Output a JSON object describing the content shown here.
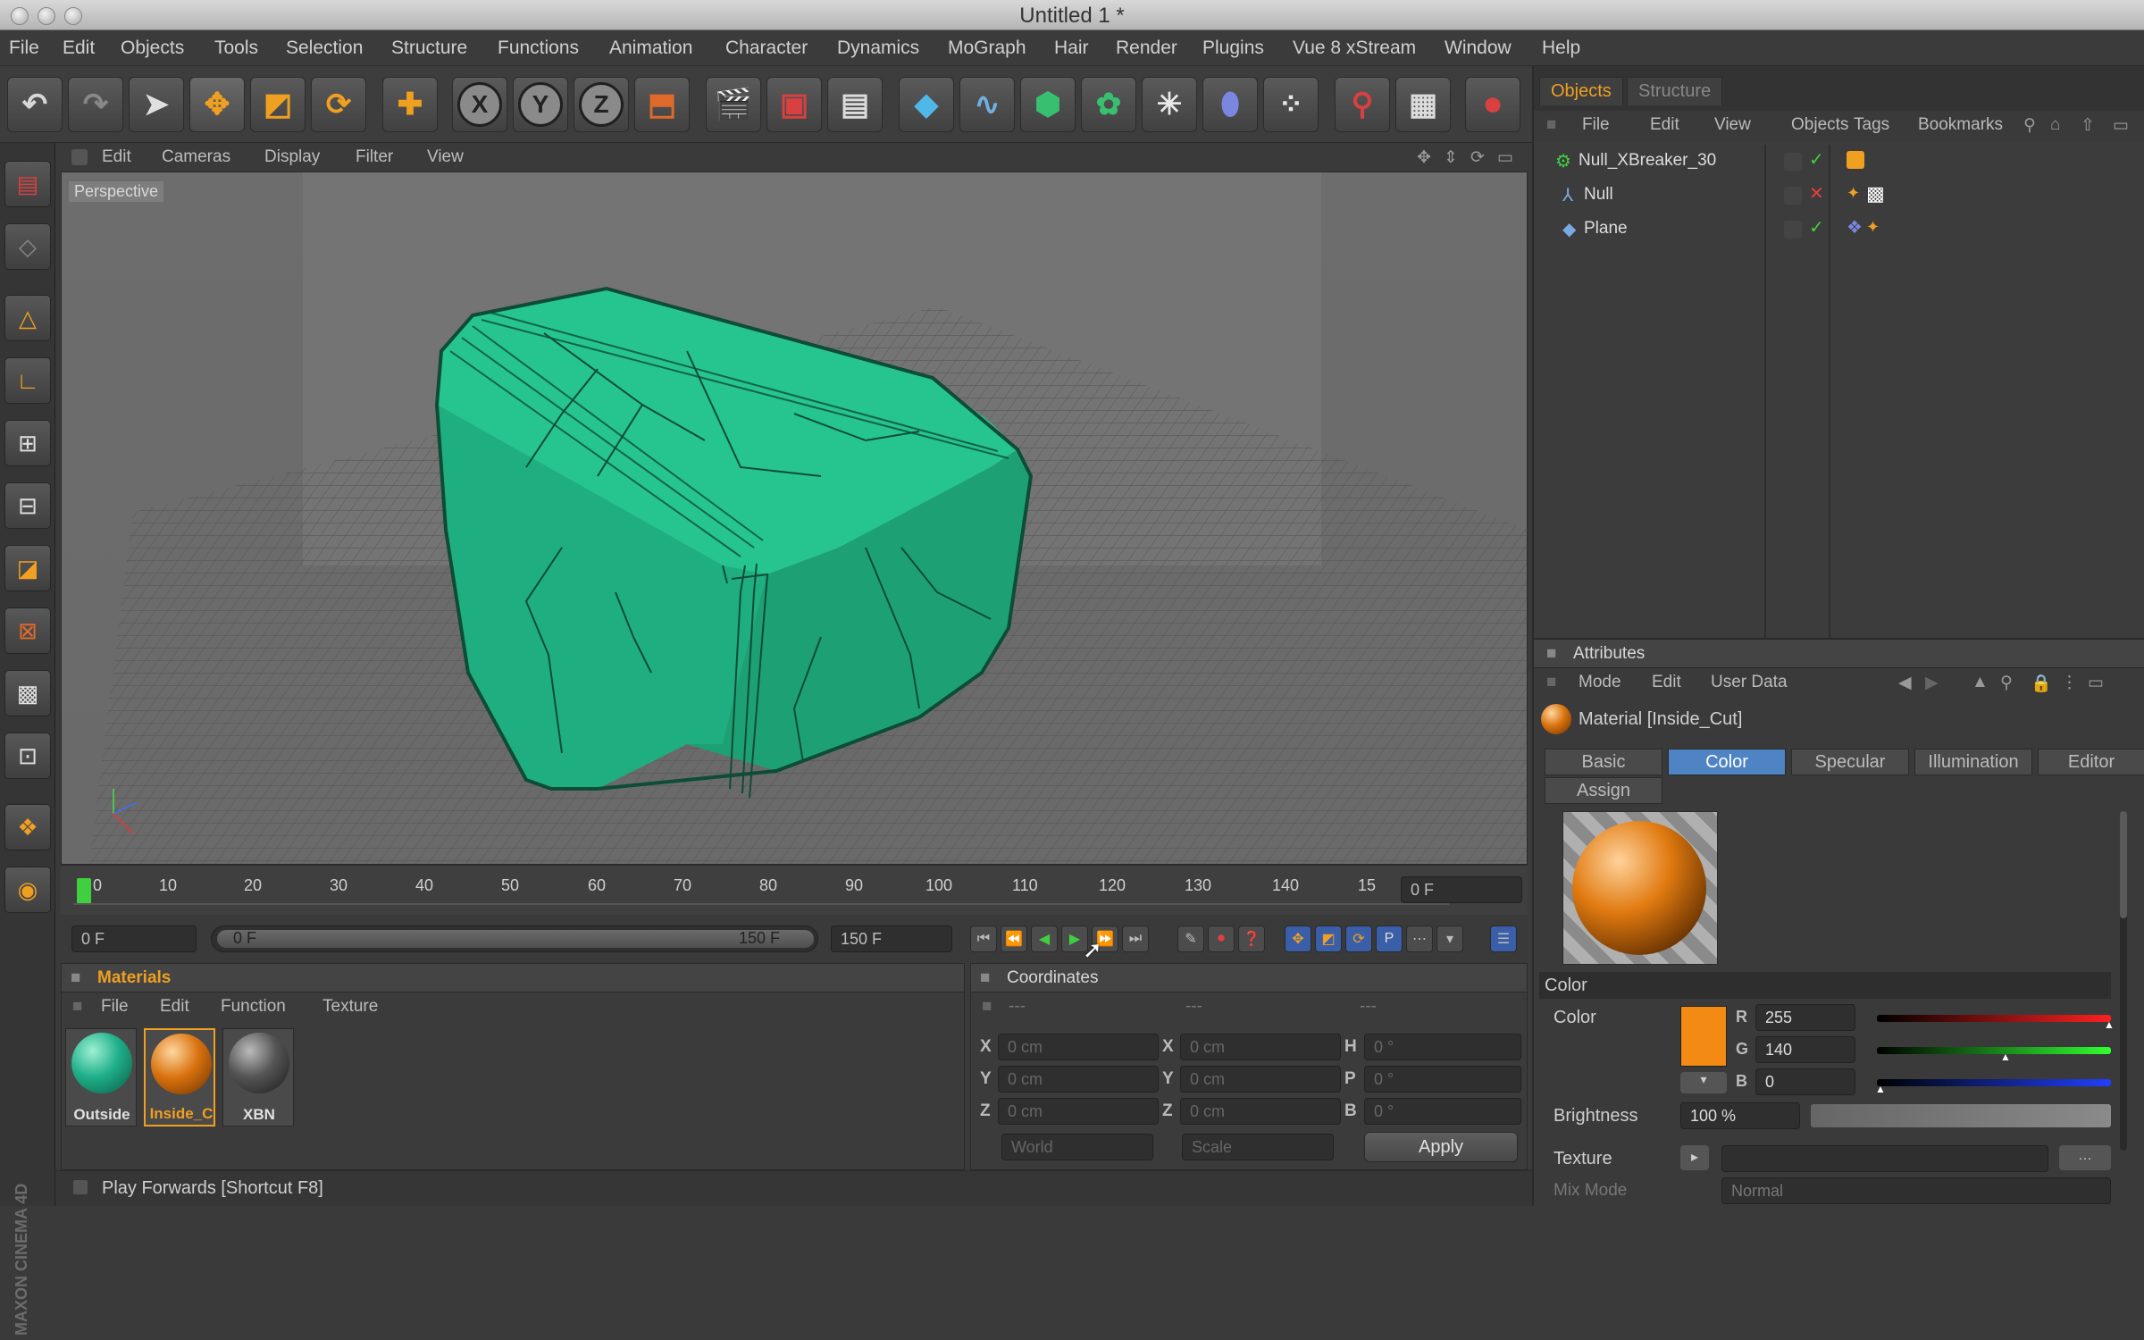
{
  "window": {
    "title": "Untitled 1 *"
  },
  "menubar": [
    "File",
    "Edit",
    "Objects",
    "Tools",
    "Selection",
    "Structure",
    "Functions",
    "Animation",
    "Character",
    "Dynamics",
    "MoGraph",
    "Hair",
    "Render",
    "Plugins",
    "Vue 8 xStream",
    "Window",
    "Help"
  ],
  "toolbar": {
    "icons": [
      "undo-icon",
      "redo-icon",
      "live-select-icon",
      "move-icon",
      "scale-icon",
      "rotate-icon",
      "world-axis-icon",
      "x-axis-icon",
      "y-axis-icon",
      "z-axis-icon",
      "coordinate-system-icon",
      "render-view-icon",
      "render-picture-viewer-icon",
      "render-settings-icon",
      "cube-primitive-icon",
      "spline-icon",
      "nurbs-icon",
      "array-icon",
      "particle-icon",
      "deformer-icon",
      "scene-icon",
      "light-icon",
      "camera-icon",
      "mograph-icon"
    ],
    "axis_labels": {
      "x": "X",
      "y": "Y",
      "z": "Z"
    }
  },
  "viewport": {
    "menu": [
      "Edit",
      "Cameras",
      "Display",
      "Filter",
      "View"
    ],
    "label": "Perspective",
    "object_color": "#1fb07a"
  },
  "timeline": {
    "ticks": [
      "0",
      "10",
      "20",
      "30",
      "40",
      "50",
      "60",
      "70",
      "80",
      "90",
      "100",
      "110",
      "120",
      "130",
      "140",
      "15"
    ],
    "current_frame": "0 F",
    "start_field": "0 F",
    "range_start": "0 F",
    "range_end": "150 F",
    "end_field": "150 F"
  },
  "materials": {
    "title": "Materials",
    "menu": [
      "File",
      "Edit",
      "Function",
      "Texture"
    ],
    "items": [
      {
        "name": "Outside",
        "color": "#1fb08a"
      },
      {
        "name": "Inside_C",
        "color": "#d9730f"
      },
      {
        "name": "XBN",
        "color": "#555555"
      }
    ]
  },
  "coordinates": {
    "title": "Coordinates",
    "headers": [
      "---",
      "---",
      "---"
    ],
    "rows": [
      {
        "pos_label": "X",
        "pos": "0 cm",
        "size_label": "X",
        "size": "0 cm",
        "rot_label": "H",
        "rot": "0 °"
      },
      {
        "pos_label": "Y",
        "pos": "0 cm",
        "size_label": "Y",
        "size": "0 cm",
        "rot_label": "P",
        "rot": "0 °"
      },
      {
        "pos_label": "Z",
        "pos": "0 cm",
        "size_label": "Z",
        "size": "0 cm",
        "rot_label": "B",
        "rot": "0 °"
      }
    ],
    "mode1": "World",
    "mode2": "Scale",
    "apply": "Apply"
  },
  "status": {
    "text": "Play Forwards [Shortcut F8]",
    "brand": "MAXON CINEMA 4D"
  },
  "object_manager": {
    "tabs": [
      "Objects",
      "Structure"
    ],
    "menu": [
      "File",
      "Edit",
      "View",
      "Objects",
      "Tags",
      "Bookmarks"
    ],
    "objects": [
      {
        "name": "Null_XBreaker_30",
        "icon": "null-icon"
      },
      {
        "name": "Null",
        "icon": "null-icon"
      },
      {
        "name": "Plane",
        "icon": "plane-icon"
      }
    ]
  },
  "attributes": {
    "title": "Attributes",
    "menu": [
      "Mode",
      "Edit",
      "User Data"
    ],
    "material_name": "Material [Inside_Cut]",
    "tabs": [
      "Basic",
      "Color",
      "Specular",
      "Illumination",
      "Editor"
    ],
    "assign_tab": "Assign",
    "section": "Color",
    "color_label": "Color",
    "swatch": "#f28a14",
    "r_label": "R",
    "r": "255",
    "g_label": "G",
    "g": "140",
    "b_label": "B",
    "b": "0",
    "brightness_label": "Brightness",
    "brightness": "100 %",
    "texture_label": "Texture",
    "mix_mode_label": "Mix Mode",
    "mix_mode": "Normal"
  }
}
